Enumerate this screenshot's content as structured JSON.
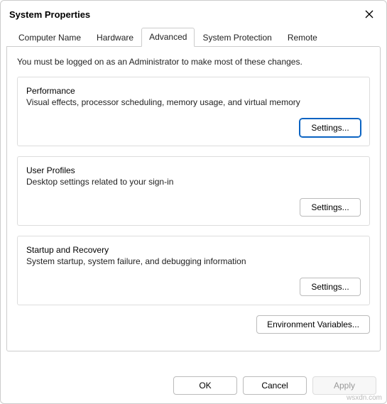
{
  "window": {
    "title": "System Properties"
  },
  "tabs": [
    {
      "label": "Computer Name"
    },
    {
      "label": "Hardware"
    },
    {
      "label": "Advanced"
    },
    {
      "label": "System Protection"
    },
    {
      "label": "Remote"
    }
  ],
  "active_tab": "Advanced",
  "intro": "You must be logged on as an Administrator to make most of these changes.",
  "performance": {
    "legend": "Performance",
    "desc": "Visual effects, processor scheduling, memory usage, and virtual memory",
    "button": "Settings..."
  },
  "user_profiles": {
    "legend": "User Profiles",
    "desc": "Desktop settings related to your sign-in",
    "button": "Settings..."
  },
  "startup_recovery": {
    "legend": "Startup and Recovery",
    "desc": "System startup, system failure, and debugging information",
    "button": "Settings..."
  },
  "env_button": "Environment Variables...",
  "footer": {
    "ok": "OK",
    "cancel": "Cancel",
    "apply": "Apply"
  },
  "watermark": "wsxdn.com"
}
